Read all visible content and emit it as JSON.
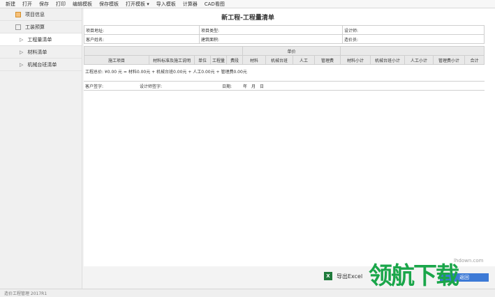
{
  "toolbar": {
    "items": [
      "新建",
      "打开",
      "保存",
      "打印",
      "编辑模板",
      "保存模板",
      "打开模板 ▾",
      "导入模板",
      "计算器",
      "CAD看图"
    ]
  },
  "sidebar": {
    "items": [
      {
        "label": "项目信息",
        "icon": "document-icon"
      },
      {
        "label": "工装预算",
        "icon": "checkbox-icon"
      },
      {
        "label": "工程量清单",
        "icon": "arrow-icon",
        "active": true
      },
      {
        "label": "材料清单",
        "icon": "arrow-icon"
      },
      {
        "label": "机械台班清单",
        "icon": "arrow-icon"
      }
    ]
  },
  "document": {
    "title": "新工程-工程量清单",
    "info": {
      "row1": [
        "项目地址:",
        "项目类型:",
        "设计师:"
      ],
      "row2": [
        "客户姓名:",
        "建筑面积:",
        "造价员:"
      ]
    },
    "grid": {
      "group_header": "单价",
      "columns": [
        "施工项目",
        "材料标准及施工说明",
        "单位",
        "工程量",
        "费段",
        "材料",
        "机械台班",
        "人工",
        "管理费",
        "材料小计",
        "机械台班小计",
        "人工小计",
        "管理费小计",
        "合计"
      ]
    },
    "summary": "工程总价: ¥0.00 元 = 材料0.00元 + 机械台班0.00元 + 人工0.00元 + 管理费0.00元",
    "signatures": [
      "客户签字:",
      "设计师签字:",
      "日期:",
      "年",
      "月",
      "日"
    ]
  },
  "footer": {
    "export_label": "导出Excel",
    "hidden_btn_label": "返回"
  },
  "status": {
    "text": "造价工程管理 2017R1"
  },
  "watermark": {
    "brand": "领航下载",
    "domain": "lhdown.com"
  },
  "colors": {
    "accent": "#3d7ad6",
    "excel": "#1f7a3b",
    "watermark": "#1aa64a"
  }
}
